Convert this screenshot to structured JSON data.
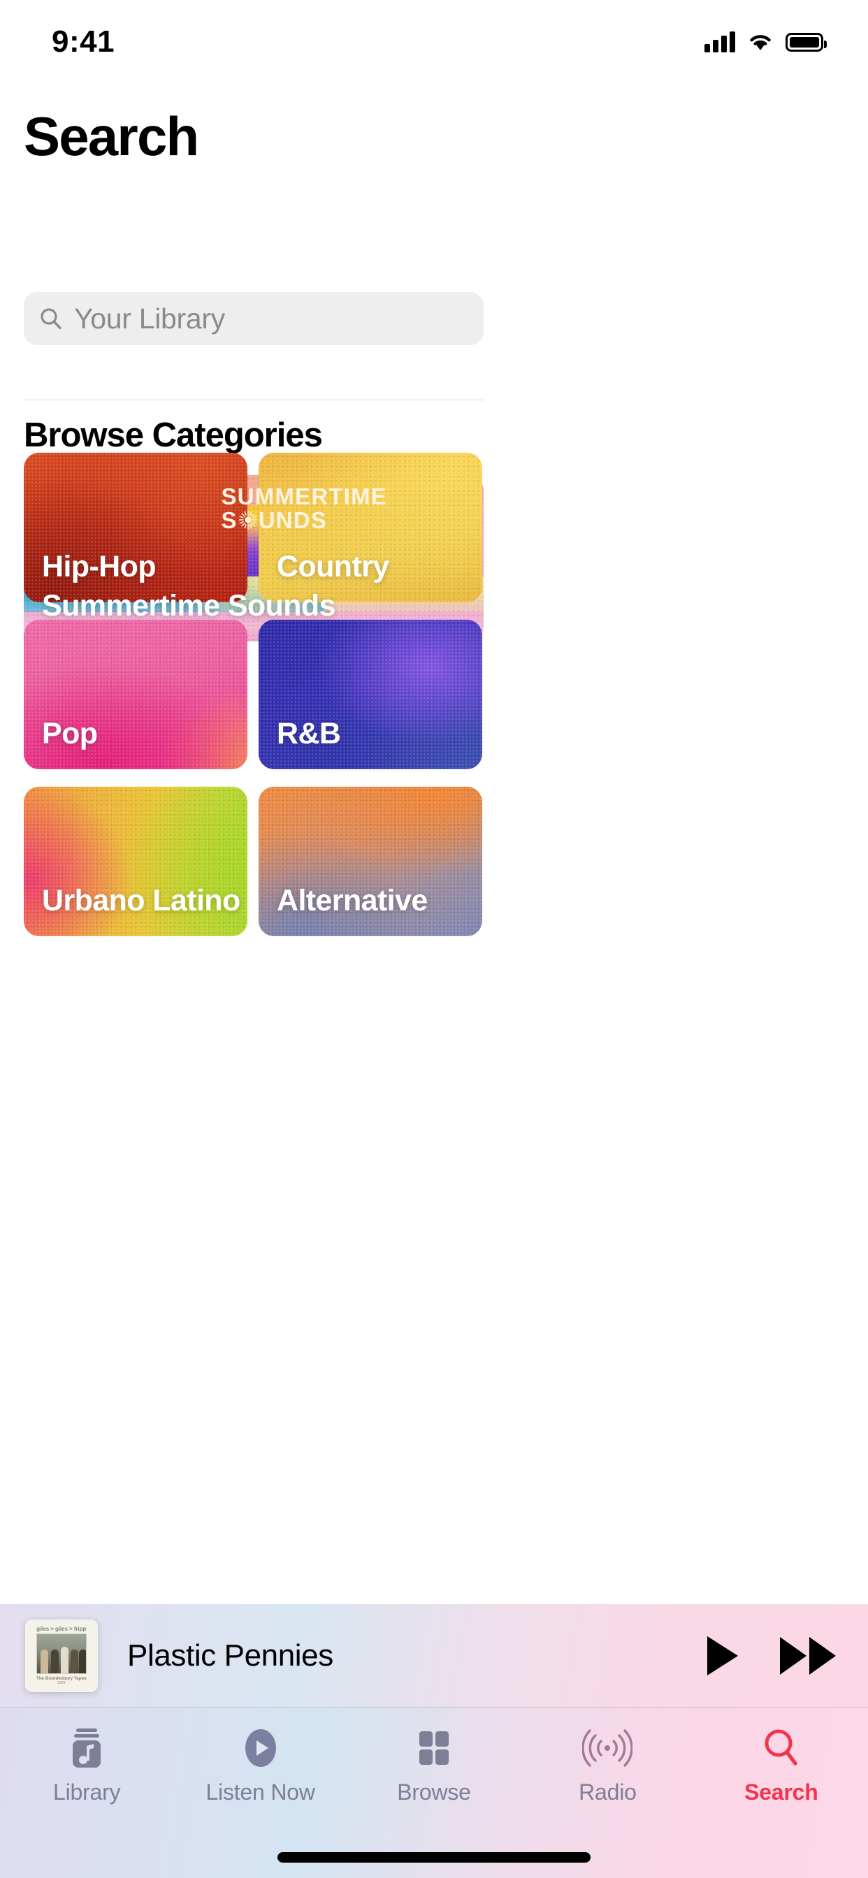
{
  "status_bar": {
    "time": "9:41",
    "cellular_icon": "cellular-signal-icon",
    "wifi_icon": "wifi-icon",
    "battery_icon": "battery-icon"
  },
  "header": {
    "title": "Search"
  },
  "search": {
    "placeholder": "Your Library",
    "value": "",
    "icon": "search-icon"
  },
  "browse": {
    "section_title": "Browse Categories",
    "banner": {
      "label": "Summertime Sounds",
      "logo_line1": "SUMMERTIME",
      "logo_line2_before": "S",
      "logo_line2_after": "UNDS",
      "logo_sun_icon": "sunburst-icon"
    },
    "categories": [
      {
        "label": "Hip-Hop",
        "accent": "#c5301a"
      },
      {
        "label": "Country",
        "accent": "#f3c948"
      },
      {
        "label": "Pop",
        "accent": "#e83a8e"
      },
      {
        "label": "R&B",
        "accent": "#3730b4"
      },
      {
        "label": "Urbano Latino",
        "accent": "#e8c634"
      },
      {
        "label": "Alternative",
        "accent": "#d98a62"
      }
    ]
  },
  "now_playing": {
    "track_title": "Plastic Pennies",
    "artwork_top_text": "giles > giles > fripp",
    "artwork_bottom_text": "The Brondesbury Tapes",
    "artwork_year": "1968",
    "play_button_label": "play-button",
    "forward_button_label": "fast-forward-button"
  },
  "tab_bar": {
    "active_color": "#f5334f",
    "inactive_color": "#7c7f96",
    "tabs": [
      {
        "label": "Library",
        "icon": "library-icon",
        "active": false
      },
      {
        "label": "Listen Now",
        "icon": "play-circle-icon",
        "active": false
      },
      {
        "label": "Browse",
        "icon": "grid-icon",
        "active": false
      },
      {
        "label": "Radio",
        "icon": "radio-waves-icon",
        "active": false
      },
      {
        "label": "Search",
        "icon": "search-icon",
        "active": true
      }
    ]
  }
}
